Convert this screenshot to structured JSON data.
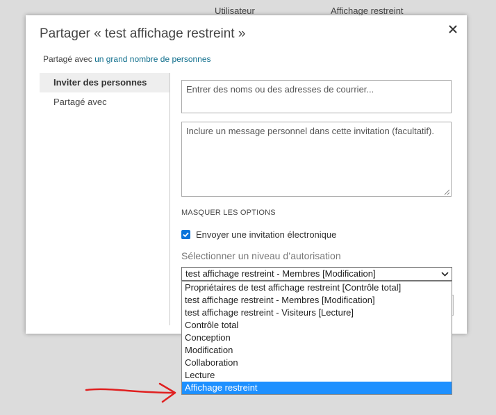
{
  "background": {
    "col1_header": "Utilisateur",
    "col2_header": "Affichage restreint"
  },
  "dialog": {
    "title": "Partager « test affichage restreint »",
    "shared_prefix": "Partagé avec",
    "shared_link": "un grand nombre de personnes",
    "nav": [
      {
        "label": "Inviter des personnes",
        "active": true
      },
      {
        "label": "Partagé avec",
        "active": false
      }
    ],
    "names_placeholder": "Entrer des noms ou des adresses de courrier...",
    "message_placeholder": "Inclure un message personnel dans cette invitation (facultatif).",
    "options_toggle": "MASQUER LES OPTIONS",
    "send_invite_label": "Envoyer une invitation électronique",
    "send_invite_checked": true,
    "permission_label": "Sélectionner un niveau d’autorisation",
    "permission_selected": "test affichage restreint - Membres [Modification]",
    "permission_options": [
      "Propriétaires de test affichage restreint [Contrôle total]",
      "test affichage restreint - Membres [Modification]",
      "test affichage restreint - Visiteurs [Lecture]",
      "Contrôle total",
      "Conception",
      "Modification",
      "Collaboration",
      "Lecture",
      "Affichage restreint"
    ],
    "highlighted_option": "Affichage restreint"
  },
  "colors": {
    "accent": "#1e90ff",
    "link": "#0f6e8c",
    "checkbox": "#0a74da",
    "annotation_arrow": "#e02020"
  },
  "icons": {
    "close": "close-icon",
    "chevron": "chevron-down-icon",
    "check": "check-icon",
    "resize": "resize-grip-icon"
  }
}
